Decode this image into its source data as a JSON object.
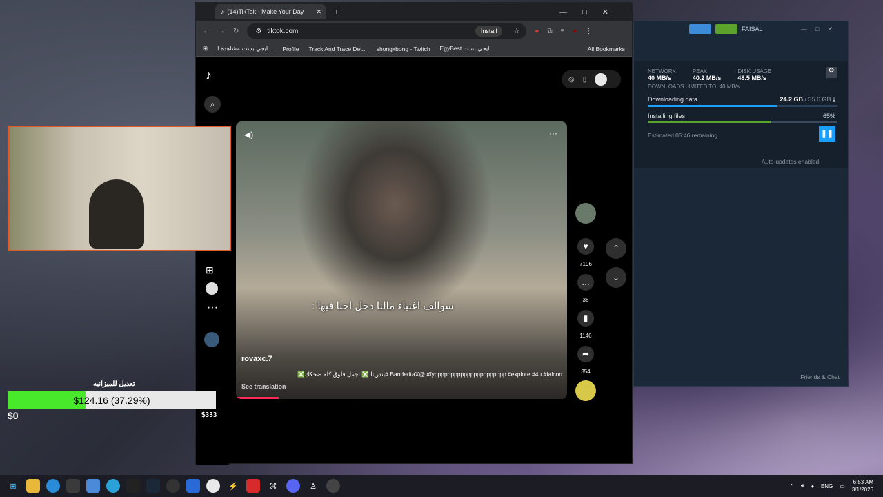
{
  "browser": {
    "tab_title": "(14)TikTok - Make Your Day",
    "url": "tiktok.com",
    "install_label": "Install",
    "bookmarks": [
      "ايجي بست مشاهدة ا...",
      "Profile",
      "Track And Trace Det...",
      "shongxbong - Twitch",
      "EgyBest ايجي بست"
    ],
    "all_bookmarks": "All Bookmarks"
  },
  "tiktok": {
    "caption": "سوالف اغنياء مالنا دخل احنا فيها :",
    "username": "rovaxc.7",
    "description": "BanderitaX@ #fypppppppppppppppppppppp #explore #4u #falcon #بندريتا ❎ اجمل فلوق كله ضحكك❎",
    "see_translation": "See translation",
    "likes": "7196",
    "comments": "36",
    "saves": "1146",
    "shares": "354",
    "balance": "$333"
  },
  "steam": {
    "user": "FAISAL",
    "network_label": "NETWORK",
    "network_val": "40 MB/s",
    "peak_label": "PEAK",
    "peak_val": "40.2 MB/s",
    "disk_label": "DISK USAGE",
    "disk_val": "48.5 MB/s",
    "limit": "DOWNLOADS LIMITED TO:",
    "limit_val": "40 MB/s",
    "downloading": "Downloading data",
    "dl_progress": "24.2 GB",
    "dl_total": "/ 35.6 GB",
    "installing": "Installing files",
    "install_pct": "65%",
    "remaining": "Estimated 05:46 remaining",
    "auto": "Auto-updates enabled",
    "friends": "Friends & Chat",
    "install_fraction": 0.65,
    "download_fraction": 0.68
  },
  "budget": {
    "title": "تعديل للميزانيه",
    "value": "$124.16 (37.29%)",
    "min": "$0",
    "fraction": 0.3729
  },
  "taskbar": {
    "lang": "ENG",
    "time": "6:53 AM",
    "date": "3/1/2026"
  }
}
